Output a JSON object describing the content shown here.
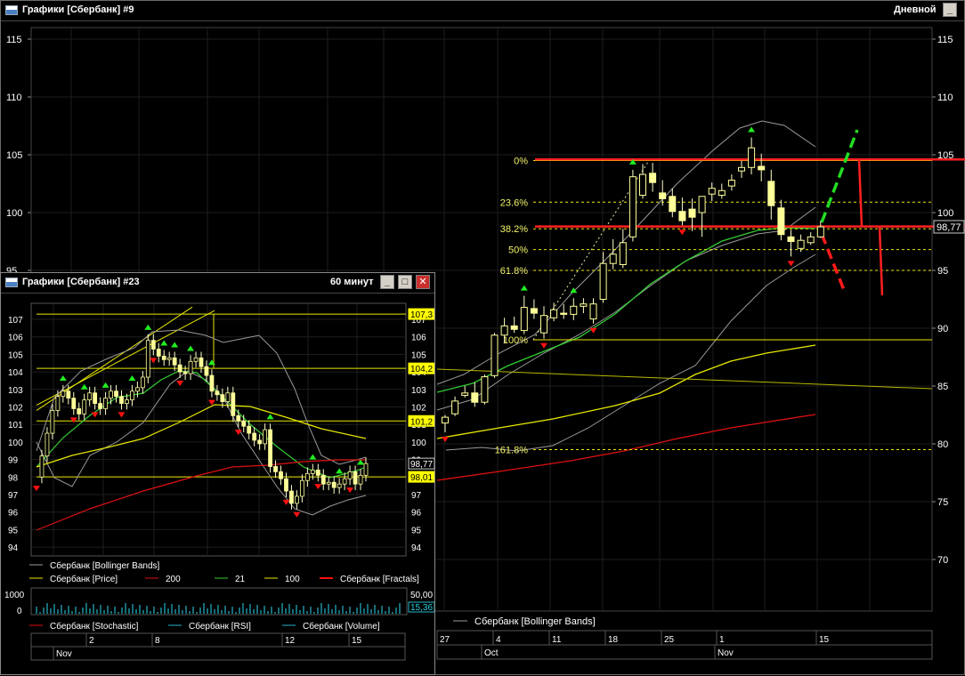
{
  "main_window": {
    "title": "Графики [Сбербанк] #9",
    "period": "Дневной",
    "minimize_label": "_",
    "legend": "Сбербанк [Bollinger Bands]",
    "date_labels": [
      "27",
      "4",
      "11",
      "18",
      "25",
      "1",
      "15"
    ],
    "month_labels": [
      "Oct",
      "Nov"
    ],
    "last_price": "98,77",
    "fib_labels": [
      "0%",
      "23.6%",
      "38.2%",
      "50%",
      "61.8%",
      "100%",
      "161.8%"
    ]
  },
  "sub_window": {
    "title": "Графики [Сбербанк] #23",
    "period": "60 минут",
    "legend_row1": [
      "Сбербанк [Bollinger Bands]"
    ],
    "legend_row2": [
      "Сбербанк [Price]",
      "200",
      "21",
      "100",
      "Сбербанк [Fractals]"
    ],
    "indicator_legend": [
      "Сбербанк [Stochastic]",
      "Сбербанк [RSI]",
      "Сбербанк [Volume]"
    ],
    "date_labels": [
      "2",
      "8",
      "12",
      "15"
    ],
    "month_labels": [
      "Nov"
    ],
    "indicator_axis": [
      "50,00",
      "15,36"
    ],
    "left_axis": [
      "1000",
      "0"
    ],
    "price_tags": [
      "107,3",
      "104,2",
      "101,2",
      "98,77",
      "98,01"
    ]
  },
  "colors": {
    "candle_up": "#ffff99",
    "candle_down": "#ffff99",
    "ma_yellow": "#e8e800",
    "ma_green": "#33cc33",
    "ma_red": "#dd1111",
    "bands": "#9a9a9a",
    "fib": "#e8e800",
    "fractal_up": "#22ee22",
    "fractal_down": "#ff1111",
    "sr_line": "#ff2020",
    "forecast_green": "#22dd22",
    "forecast_red": "#ff1a1a",
    "grid": "#1e1e1e"
  },
  "chart_data": [
    {
      "type": "candlestick",
      "title": "Графики [Сбербанк] #9",
      "timeframe": "Дневной",
      "ylim": [
        65,
        116
      ],
      "y_ticks": [
        70,
        75,
        80,
        85,
        90,
        95,
        100,
        105,
        110,
        115
      ],
      "x_tick_labels": [
        "27",
        "4",
        "11",
        "18",
        "25",
        "1",
        "15"
      ],
      "candles": [
        {
          "o": 81.8,
          "h": 82.5,
          "l": 81.0,
          "c": 82.3
        },
        {
          "o": 82.6,
          "h": 84.1,
          "l": 82.4,
          "c": 83.7
        },
        {
          "o": 84.2,
          "h": 85.0,
          "l": 84.0,
          "c": 84.4
        },
        {
          "o": 84.4,
          "h": 85.3,
          "l": 83.2,
          "c": 83.6
        },
        {
          "o": 83.6,
          "h": 86.0,
          "l": 83.4,
          "c": 85.8
        },
        {
          "o": 85.9,
          "h": 89.6,
          "l": 85.7,
          "c": 89.4
        },
        {
          "o": 89.4,
          "h": 90.9,
          "l": 88.7,
          "c": 90.2
        },
        {
          "o": 90.2,
          "h": 91.0,
          "l": 89.6,
          "c": 89.9
        },
        {
          "o": 89.8,
          "h": 92.8,
          "l": 89.5,
          "c": 91.8
        },
        {
          "o": 91.7,
          "h": 92.5,
          "l": 90.8,
          "c": 91.3
        },
        {
          "o": 89.6,
          "h": 91.9,
          "l": 89.1,
          "c": 91.1
        },
        {
          "o": 90.9,
          "h": 92.2,
          "l": 90.6,
          "c": 91.6
        },
        {
          "o": 91.3,
          "h": 92.1,
          "l": 90.8,
          "c": 91.2
        },
        {
          "o": 91.2,
          "h": 92.6,
          "l": 90.7,
          "c": 91.9
        },
        {
          "o": 91.9,
          "h": 92.6,
          "l": 91.3,
          "c": 92.1
        },
        {
          "o": 90.8,
          "h": 92.6,
          "l": 90.4,
          "c": 92.1
        },
        {
          "o": 92.5,
          "h": 96.6,
          "l": 92.2,
          "c": 95.6
        },
        {
          "o": 95.6,
          "h": 97.7,
          "l": 95.1,
          "c": 96.4
        },
        {
          "o": 95.5,
          "h": 98.6,
          "l": 95.2,
          "c": 97.4
        },
        {
          "o": 97.9,
          "h": 103.7,
          "l": 97.5,
          "c": 103.1
        },
        {
          "o": 101.5,
          "h": 104.2,
          "l": 101.2,
          "c": 103.3
        },
        {
          "o": 103.4,
          "h": 104.3,
          "l": 101.8,
          "c": 102.6
        },
        {
          "o": 101.7,
          "h": 102.8,
          "l": 100.6,
          "c": 101.2
        },
        {
          "o": 101.4,
          "h": 102.1,
          "l": 99.6,
          "c": 100.1
        },
        {
          "o": 100.1,
          "h": 101.3,
          "l": 98.9,
          "c": 99.3
        },
        {
          "o": 100.3,
          "h": 101.2,
          "l": 98.4,
          "c": 99.6
        },
        {
          "o": 100.0,
          "h": 101.4,
          "l": 97.9,
          "c": 101.4
        },
        {
          "o": 101.6,
          "h": 102.6,
          "l": 101.0,
          "c": 102.1
        },
        {
          "o": 101.5,
          "h": 102.5,
          "l": 101.2,
          "c": 101.9
        },
        {
          "o": 102.3,
          "h": 103.3,
          "l": 101.9,
          "c": 102.8
        },
        {
          "o": 103.6,
          "h": 104.5,
          "l": 103.0,
          "c": 103.9
        },
        {
          "o": 103.9,
          "h": 106.5,
          "l": 103.3,
          "c": 105.6
        },
        {
          "o": 104.0,
          "h": 105.1,
          "l": 102.7,
          "c": 103.7
        },
        {
          "o": 102.7,
          "h": 103.7,
          "l": 99.4,
          "c": 100.6
        },
        {
          "o": 100.4,
          "h": 101.1,
          "l": 97.6,
          "c": 98.1
        },
        {
          "o": 97.9,
          "h": 98.5,
          "l": 96.2,
          "c": 97.5
        },
        {
          "o": 96.9,
          "h": 98.1,
          "l": 96.6,
          "c": 97.6
        },
        {
          "o": 97.4,
          "h": 98.3,
          "l": 97.2,
          "c": 97.9
        },
        {
          "o": 97.9,
          "h": 99.3,
          "l": 97.8,
          "c": 98.77
        }
      ],
      "fractals_up": [
        8,
        13,
        19,
        31
      ],
      "fractals_down": [
        0,
        10,
        15,
        24,
        35
      ],
      "fibonacci": {
        "high": 104.5,
        "low": 89.0,
        "levels": [
          {
            "label": "0%",
            "value": 104.5
          },
          {
            "label": "23.6%",
            "value": 100.9
          },
          {
            "label": "38.2%",
            "value": 98.6
          },
          {
            "label": "50%",
            "value": 96.8
          },
          {
            "label": "61.8%",
            "value": 95.0
          },
          {
            "label": "100%",
            "value": 89.0
          },
          {
            "label": "161.8%",
            "value": 79.5
          }
        ]
      },
      "support_resistance": [
        104.6,
        98.8
      ],
      "last_price": 98.77
    },
    {
      "type": "candlestick",
      "title": "Графики [Сбербанк] #23",
      "timeframe": "60 минут",
      "ylim": [
        93.4,
        108
      ],
      "y_ticks": [
        94,
        95,
        96,
        97,
        98,
        99,
        100,
        101,
        102,
        103,
        104,
        105,
        106,
        107
      ],
      "x_tick_labels": [
        "2",
        "8",
        "12",
        "15"
      ],
      "close_path": [
        98.0,
        99.2,
        100.5,
        101.8,
        102.6,
        102.9,
        102.5,
        101.9,
        101.6,
        102.4,
        102.8,
        102.2,
        101.9,
        102.5,
        102.9,
        102.6,
        102.2,
        102.4,
        102.9,
        103.1,
        103.7,
        105.8,
        105.3,
        104.9,
        104.7,
        104.8,
        104.4,
        104.0,
        103.9,
        104.6,
        104.8,
        104.3,
        103.8,
        102.9,
        102.7,
        102.3,
        102.8,
        101.5,
        101.2,
        100.9,
        100.5,
        100.1,
        99.9,
        100.7,
        98.6,
        98.3,
        97.9,
        97.2,
        96.5,
        96.9,
        97.8,
        98.2,
        98.4,
        98.1,
        97.6,
        97.7,
        97.4,
        97.6,
        97.9,
        98.3,
        97.6,
        98.1,
        98.77
      ],
      "price_tags": [
        107.3,
        104.2,
        101.2,
        98.77,
        98.01
      ]
    }
  ]
}
